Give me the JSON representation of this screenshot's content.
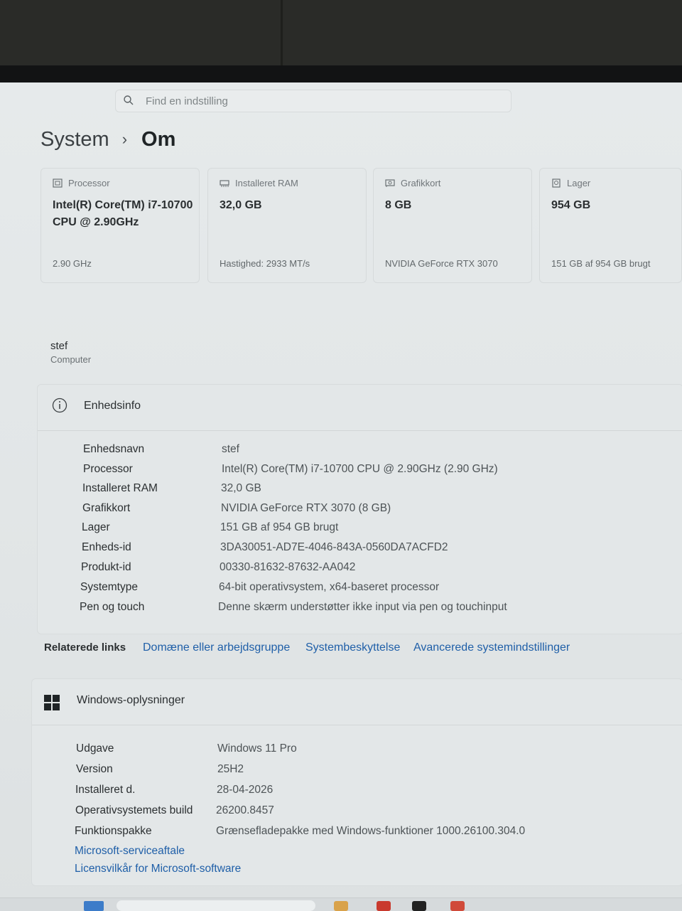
{
  "search": {
    "placeholder": "Find en indstilling"
  },
  "breadcrumb": {
    "parent": "System",
    "separator": "›",
    "current": "Om"
  },
  "cards": [
    {
      "label": "Processor",
      "icon": "processor-icon",
      "value": "Intel(R) Core(TM) i7-10700 CPU @ 2.90GHz",
      "sub": "2.90 GHz"
    },
    {
      "label": "Installeret RAM",
      "icon": "ram-icon",
      "value": "32,0 GB",
      "sub": "Hastighed: 2933 MT/s"
    },
    {
      "label": "Grafikkort",
      "icon": "graphics-card-icon",
      "value": "8 GB",
      "sub": "NVIDIA GeForce RTX 3070"
    },
    {
      "label": "Lager",
      "icon": "storage-icon",
      "value": "954 GB",
      "sub": "151 GB af 954 GB brugt"
    }
  ],
  "computer": {
    "name": "stef",
    "type": "Computer"
  },
  "device_info": {
    "title": "Enhedsinfo",
    "icon": "info-icon",
    "rows": [
      {
        "label": "Enhedsnavn",
        "value": "stef"
      },
      {
        "label": "Processor",
        "value": "Intel(R) Core(TM) i7-10700 CPU @ 2.90GHz (2.90 GHz)"
      },
      {
        "label": "Installeret RAM",
        "value": "32,0 GB"
      },
      {
        "label": "Grafikkort",
        "value": "NVIDIA GeForce RTX 3070 (8 GB)"
      },
      {
        "label": "Lager",
        "value": "151 GB af 954 GB brugt"
      },
      {
        "label": "Enheds-id",
        "value": "3DA30051-AD7E-4046-843A-0560DA7ACFD2"
      },
      {
        "label": "Produkt-id",
        "value": "00330-81632-87632-AA042"
      },
      {
        "label": "Systemtype",
        "value": "64-bit operativsystem, x64-baseret processor"
      },
      {
        "label": "Pen og touch",
        "value": "Denne skærm understøtter ikke input via pen og touchinput"
      }
    ]
  },
  "related_links": {
    "label": "Relaterede links",
    "links": [
      "Domæne eller arbejdsgruppe",
      "Systembeskyttelse",
      "Avancerede systemindstillinger"
    ]
  },
  "windows_info": {
    "title": "Windows-oplysninger",
    "icon": "windows-logo-icon",
    "rows": [
      {
        "label": "Udgave",
        "value": "Windows 11 Pro"
      },
      {
        "label": "Version",
        "value": "25H2"
      },
      {
        "label": "Installeret d.",
        "value": "28-04-2026"
      },
      {
        "label": "Operativsystemets build",
        "value": "26200.8457"
      },
      {
        "label": "Funktionspakke",
        "value": "Grænsefladepakke med Windows-funktioner 1000.26100.304.0"
      }
    ],
    "links": [
      "Microsoft-serviceaftale",
      "Licensvilkår for Microsoft-software"
    ]
  },
  "colors": {
    "link": "#1f5fa8",
    "accent": "#3d7cc9"
  }
}
